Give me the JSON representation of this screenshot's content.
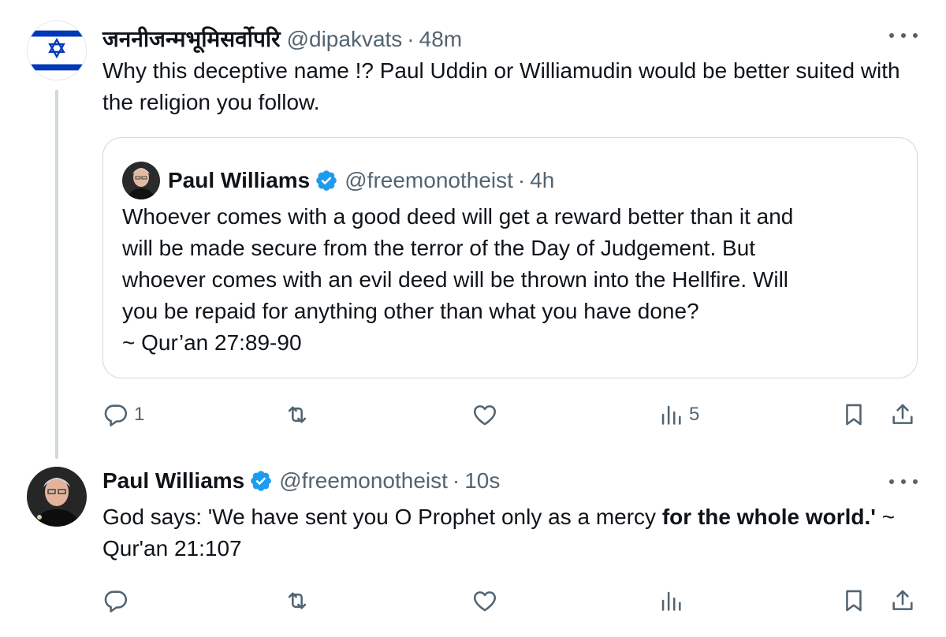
{
  "tweet1": {
    "display_name": "जननीजन्मभूमिसर्वोपरि",
    "handle": "@dipakvats",
    "separator": "·",
    "time": "48m",
    "text": "Why this deceptive name !? Paul Uddin or Williamudin would be better suited with the religion you follow.",
    "avatar_icon": "star-of-david-flag-icon",
    "quote": {
      "display_name": "Paul Williams",
      "handle": "@freemonotheist",
      "separator": "·",
      "time": "4h",
      "verified_icon": "verified-badge-icon",
      "lines": [
        "Whoever comes with a good deed will get a reward better than it and",
        "will be made secure from the terror of the Day of Judgement. But",
        "whoever comes with an evil deed will be thrown into the Hellfire. Will",
        "you be repaid for anything other than what you have done?",
        "~ Qur’an 27:89-90"
      ]
    },
    "actions": {
      "reply_count": "1",
      "retweet_count": "",
      "like_count": "",
      "views_count": "5"
    }
  },
  "tweet2": {
    "display_name": "Paul Williams",
    "handle": "@freemonotheist",
    "separator": "·",
    "time": "10s",
    "verified_icon": "verified-badge-icon",
    "text_plain": "God says: 'We have sent you O Prophet only as a mercy ",
    "text_bold": "for the whole world.'",
    "text_tail": " ~ Qur'an 21:107",
    "actions": {
      "reply_count": "",
      "retweet_count": "",
      "like_count": "",
      "views_count": ""
    }
  },
  "colors": {
    "text_primary": "#0f1419",
    "text_secondary": "#536471",
    "verified_blue": "#1d9bf0",
    "border": "#cfd9de",
    "flag_blue": "#0038b8"
  }
}
